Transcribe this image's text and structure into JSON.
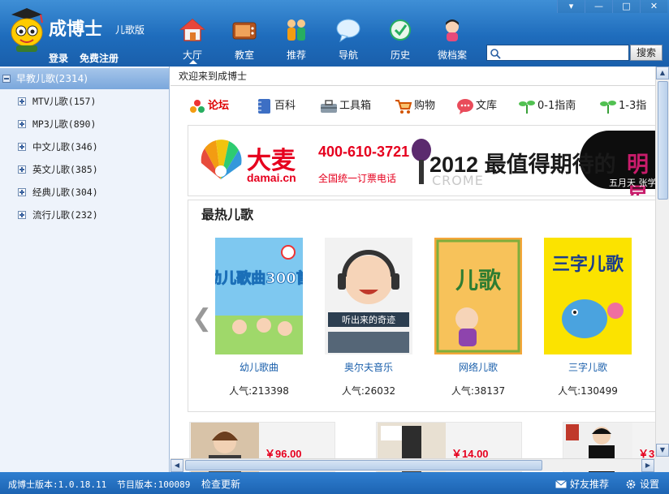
{
  "app": {
    "brand": "成博士",
    "brand_sub": "儿歌版",
    "login": "登录",
    "register": "免费注册"
  },
  "nav": [
    {
      "label": "大厅",
      "icon": "house-icon",
      "active": true
    },
    {
      "label": "教室",
      "icon": "tv-icon"
    },
    {
      "label": "推荐",
      "icon": "kids-icon"
    },
    {
      "label": "导航",
      "icon": "speech-bubble-icon"
    },
    {
      "label": "历史",
      "icon": "history-clock-icon"
    },
    {
      "label": "微档案",
      "icon": "girl-avatar-icon"
    }
  ],
  "search": {
    "value": "",
    "button": "搜索"
  },
  "window": {
    "menu": "▾",
    "minimize": "—",
    "maximize": "□",
    "close": "✕"
  },
  "sidebar": {
    "root": "早教儿歌(2314)",
    "items": [
      "MTV儿歌(157)",
      "MP3儿歌(890)",
      "中文儿歌(346)",
      "英文儿歌(385)",
      "经典儿歌(304)",
      "流行儿歌(232)"
    ]
  },
  "content": {
    "welcome": "欢迎来到成博士",
    "links": [
      {
        "label": "论坛",
        "icon": "forum-icon"
      },
      {
        "label": "百科",
        "icon": "notebook-icon"
      },
      {
        "label": "工具箱",
        "icon": "toolbox-icon"
      },
      {
        "label": "购物",
        "icon": "shopping-cart-icon"
      },
      {
        "label": "文库",
        "icon": "chat-bubble-icon"
      },
      {
        "label": "0-1指南",
        "icon": "sprout-icon"
      },
      {
        "label": "1-3指",
        "icon": "sprout-icon"
      }
    ],
    "banner": {
      "brand": "大麦",
      "brand_en": "damai.cn",
      "phone": "400-610-3721",
      "slogan": "全国统一订票电话",
      "headline": "2012 最值得期待的",
      "headline_accent": "明星",
      "names": "五月天 张学",
      "watermark": "CROME"
    },
    "hot_title": "最热儿歌",
    "songs": [
      {
        "name": "幼儿歌曲",
        "popularity": "人气:213398",
        "cover_text": "幼儿歌曲300首"
      },
      {
        "name": "奥尔夫音乐",
        "popularity": "人气:26032",
        "cover_text": "听出来的奇迹"
      },
      {
        "name": "网络儿歌",
        "popularity": "人气:38137",
        "cover_text": "儿歌"
      },
      {
        "name": "三字儿歌",
        "popularity": "人气:130499",
        "cover_text": "三字儿歌"
      }
    ],
    "ads": [
      {
        "price": "￥96.00"
      },
      {
        "price": "￥14.00"
      },
      {
        "price": "￥3"
      }
    ]
  },
  "status": {
    "app_version": "成博士版本:1.0.18.11",
    "program_version": "节目版本:100089",
    "check_update": "检查更新",
    "recommend": "好友推荐",
    "settings": "设置"
  },
  "colors": {
    "header": "#1e6cbc",
    "accent_red": "#e6001e",
    "link_blue": "#1a5fab"
  }
}
